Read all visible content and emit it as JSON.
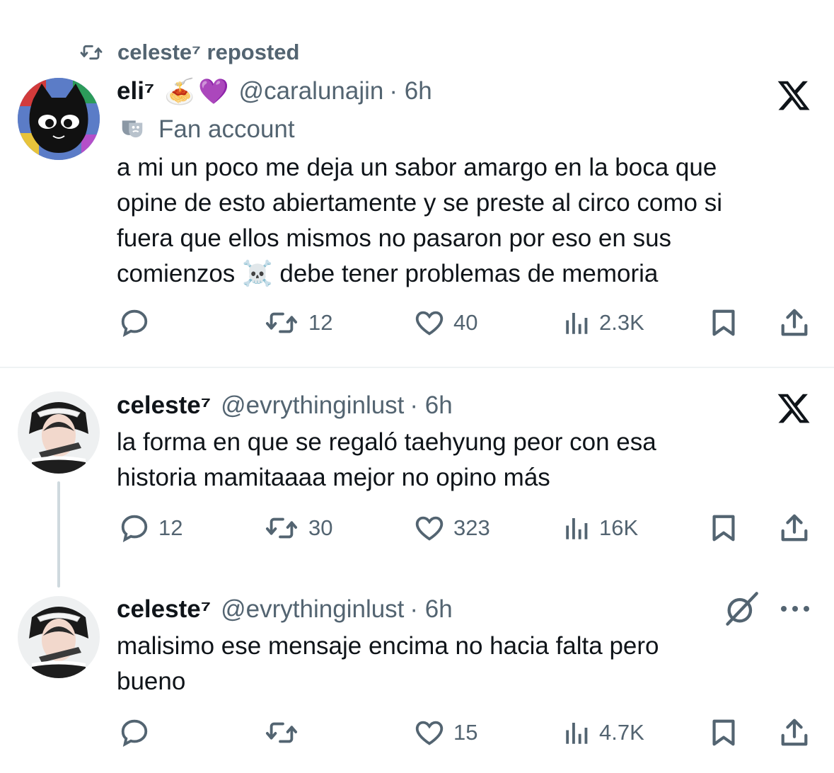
{
  "repost_banner": {
    "text": "celeste⁷ reposted"
  },
  "tweets": [
    {
      "display_name": "eli⁷",
      "emoji_1": "🍝",
      "emoji_2": "💜",
      "handle": "@caralunajin",
      "time": "· 6h",
      "account_label": "Fan account",
      "text_lines": [
        "a mi un poco me deja un sabor amargo en la boca que",
        "opine de esto abiertamente y se preste al circo como si",
        "fuera que ellos mismos no pasaron por eso en sus"
      ],
      "text_line_4a": "comienzos",
      "text_emoji": "☠️",
      "text_line_4b": "debe tener problemas de memoria",
      "replies": "",
      "reposts": "12",
      "likes": "40",
      "views": "2.3K"
    },
    {
      "display_name": "celeste⁷",
      "handle": "@evrythinginlust",
      "time": "· 6h",
      "text_lines": [
        "la forma en que se regaló taehyung peor con esa",
        "historia mamitaaaa mejor no opino más"
      ],
      "replies": "12",
      "reposts": "30",
      "likes": "323",
      "views": "16K"
    },
    {
      "display_name": "celeste⁷",
      "handle": "@evrythinginlust",
      "time": "· 6h",
      "text_lines": [
        "malisimo ese mensaje encima no hacia falta pero",
        "bueno"
      ],
      "replies": "",
      "reposts": "",
      "likes": "15",
      "views": "4.7K"
    }
  ],
  "icons": {
    "repost": "repost-icon",
    "reply": "reply-icon",
    "like": "heart-icon",
    "views": "views-icon",
    "bookmark": "bookmark-icon",
    "share": "share-icon",
    "x_logo": "x-logo-icon",
    "grok": "grok-icon",
    "more": "more-icon",
    "fan_account": "theater-masks-icon"
  },
  "colors": {
    "text": "#0f1419",
    "muted": "#536471",
    "divider": "#eff3f4",
    "thread": "#cfd9de"
  }
}
